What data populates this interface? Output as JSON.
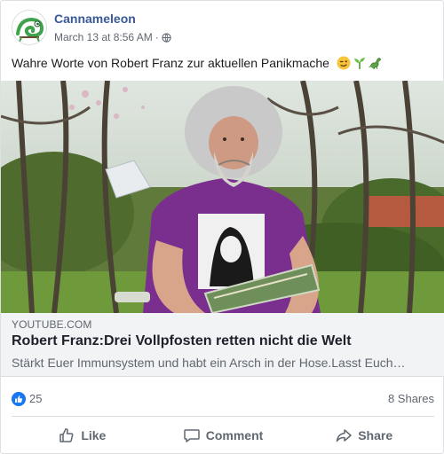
{
  "post": {
    "page_name": "Cannameleon",
    "timestamp": "March 13 at 8:56 AM",
    "separator": "·",
    "privacy_icon": "globe-icon",
    "text": "Wahre Worte von Robert Franz zur aktuellen Panikmache",
    "emojis": [
      "winking-face-emoji",
      "seedling-emoji",
      "dinosaur-emoji"
    ]
  },
  "link_preview": {
    "domain": "YOUTUBE.COM",
    "title": "Robert Franz:Drei Vollpfosten retten nicht die Welt",
    "description": "Stärkt Euer Immunsystem und habt ein Arsch in der Hose.Lasst Euch…"
  },
  "stats": {
    "like_count": "25",
    "shares": "8 Shares"
  },
  "actions": {
    "like": "Like",
    "comment": "Comment",
    "share": "Share"
  },
  "colors": {
    "brand_link": "#385898",
    "like_blue": "#1877f2",
    "meta_gray": "#606770",
    "shirt_purple": "#7a2f8f"
  }
}
